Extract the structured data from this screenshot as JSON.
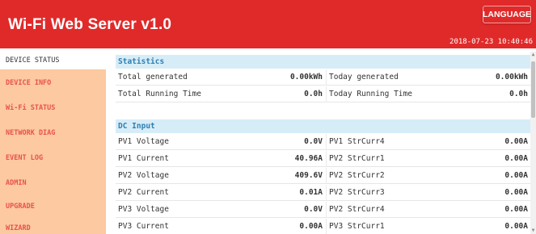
{
  "header": {
    "title": "Wi-Fi Web Server v1.0",
    "language_button": "LANGUAGE",
    "timestamp": "2018-07-23 10:40:46"
  },
  "sidebar": {
    "items": [
      {
        "label": "DEVICE STATUS",
        "active": true
      },
      {
        "label": "DEVICE INFO",
        "active": false
      },
      {
        "label": "Wi-Fi STATUS",
        "active": false
      },
      {
        "label": "NETWORK DIAG",
        "active": false
      },
      {
        "label": "EVENT LOG",
        "active": false
      },
      {
        "label": "ADMIN",
        "active": false
      },
      {
        "label": "UPGRADE",
        "active": false
      },
      {
        "label": "WIZARD",
        "active": false
      }
    ]
  },
  "statistics": {
    "heading": "Statistics",
    "rows": [
      {
        "l1": "Total generated",
        "v1": "0.00kWh",
        "l2": "Today generated",
        "v2": "0.00kWh"
      },
      {
        "l1": "Total Running Time",
        "v1": "0.0h",
        "l2": "Today Running Time",
        "v2": "0.0h"
      }
    ]
  },
  "dc_input": {
    "heading": "DC Input",
    "rows": [
      {
        "l1": "PV1 Voltage",
        "v1": "0.0V",
        "l2": "PV1 StrCurr4",
        "v2": "0.00A"
      },
      {
        "l1": "PV1 Current",
        "v1": "40.96A",
        "l2": "PV2 StrCurr1",
        "v2": "0.00A"
      },
      {
        "l1": "PV2 Voltage",
        "v1": "409.6V",
        "l2": "PV2 StrCurr2",
        "v2": "0.00A"
      },
      {
        "l1": "PV2 Current",
        "v1": "0.01A",
        "l2": "PV2 StrCurr3",
        "v2": "0.00A"
      },
      {
        "l1": "PV3 Voltage",
        "v1": "0.0V",
        "l2": "PV2 StrCurr4",
        "v2": "0.00A"
      },
      {
        "l1": "PV3 Current",
        "v1": "0.00A",
        "l2": "PV3 StrCurr1",
        "v2": "0.00A"
      }
    ]
  },
  "colors": {
    "header_bg": "#e02a2a",
    "sidebar_bg": "#fcc9a0",
    "sidebar_text": "#e8534a",
    "section_bg": "#d6edf7",
    "section_text": "#2e7fb3"
  }
}
